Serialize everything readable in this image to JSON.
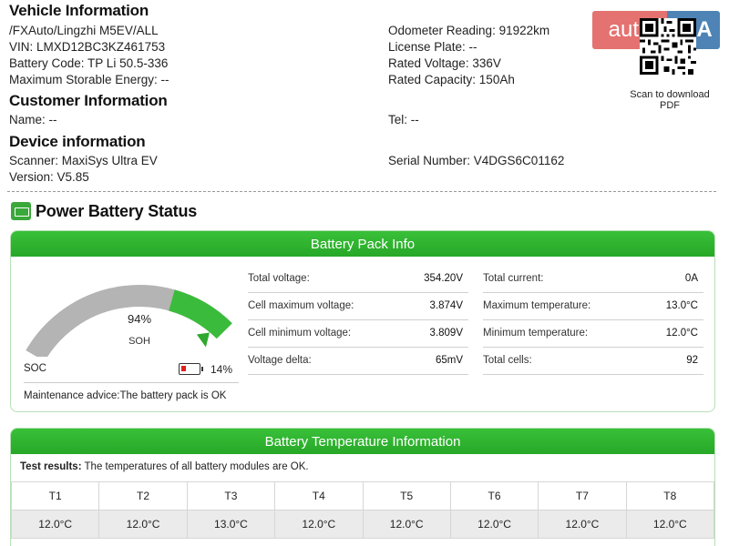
{
  "vehicle": {
    "heading": "Vehicle Information",
    "path": "/FXAuto/Lingzhi M5EV/ALL",
    "vin": "VIN: LMXD12BC3KZ461753",
    "battery_code": "Battery Code: TP Li 50.5-336",
    "max_energy": "Maximum Storable Energy: --",
    "odometer": "Odometer Reading: 91922km",
    "plate": "License Plate: --",
    "rated_voltage": "Rated Voltage: 336V",
    "rated_capacity": "Rated Capacity: 150Ah"
  },
  "customer": {
    "heading": "Customer Information",
    "name": "Name: --",
    "tel": "Tel: --"
  },
  "device": {
    "heading": "Device information",
    "scanner": "Scanner: MaxiSys Ultra EV",
    "version": "Version: V5.85",
    "serial": "Serial Number: V4DGS6C01162"
  },
  "watermark": {
    "text_left": "auto",
    "text_right": "RIA"
  },
  "qr": {
    "caption_1": "Scan to download",
    "caption_2": "PDF"
  },
  "status_title": "Power Battery Status",
  "pack": {
    "header": "Battery Pack Info",
    "soh_value": "94%",
    "soh_label": "SOH",
    "soh_fraction": 0.94,
    "soc_label": "SOC",
    "soc_value": "14%",
    "soc_fraction": 0.14,
    "advice_label": "Maintenance advice:",
    "advice_text": "The battery pack is OK",
    "colors": {
      "gauge_fill": "#3bbb3b",
      "gauge_track": "#b4b4b4",
      "low_battery": "#e02020"
    },
    "left_rows": [
      {
        "label": "Total voltage:",
        "value": "354.20V"
      },
      {
        "label": "Cell maximum voltage:",
        "value": "3.874V"
      },
      {
        "label": "Cell minimum voltage:",
        "value": "3.809V"
      },
      {
        "label": "Voltage delta:",
        "value": "65mV"
      }
    ],
    "right_rows": [
      {
        "label": "Total current:",
        "value": "0A"
      },
      {
        "label": "Maximum temperature:",
        "value": "13.0°C"
      },
      {
        "label": "Minimum temperature:",
        "value": "12.0°C"
      },
      {
        "label": "Total cells:",
        "value": "92"
      }
    ]
  },
  "temperature": {
    "header": "Battery Temperature Information",
    "result_label": "Test results:",
    "result_text": " The temperatures of all battery modules are OK.",
    "sensors": [
      "T1",
      "T2",
      "T3",
      "T4",
      "T5",
      "T6",
      "T7",
      "T8"
    ],
    "values": [
      "12.0°C",
      "12.0°C",
      "13.0°C",
      "12.0°C",
      "12.0°C",
      "12.0°C",
      "12.0°C",
      "12.0°C"
    ]
  }
}
